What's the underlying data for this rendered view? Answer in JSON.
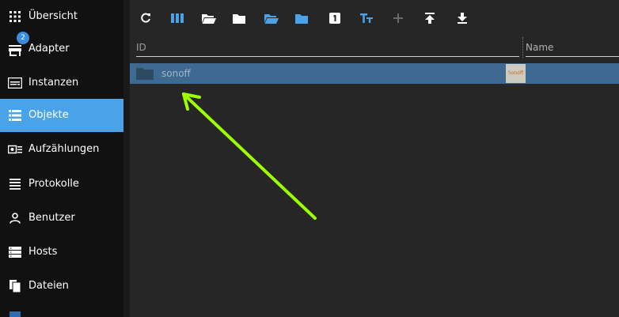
{
  "sidebar": {
    "items": [
      {
        "label": "Übersicht",
        "icon": "grid-icon"
      },
      {
        "label": "Adapter",
        "icon": "store-icon",
        "badge": "2"
      },
      {
        "label": "Instanzen",
        "icon": "instances-icon"
      },
      {
        "label": "Objekte",
        "icon": "list-icon",
        "active": true
      },
      {
        "label": "Aufzählungen",
        "icon": "enum-icon"
      },
      {
        "label": "Protokolle",
        "icon": "log-icon"
      },
      {
        "label": "Benutzer",
        "icon": "user-icon"
      },
      {
        "label": "Hosts",
        "icon": "hosts-icon"
      },
      {
        "label": "Dateien",
        "icon": "files-icon"
      }
    ]
  },
  "toolbar": {
    "buttons": [
      "refresh-icon",
      "columns-icon",
      "folder-open-icon",
      "folder-icon",
      "folder-open-blue-icon",
      "folder-blue-icon",
      "one-icon",
      "text-size-icon",
      "plus-icon",
      "upload-icon",
      "download-icon"
    ]
  },
  "table": {
    "columns": {
      "id": "ID",
      "name": "Name"
    },
    "rows": [
      {
        "id": "sonoff",
        "thumb_text": "Sonoff"
      }
    ]
  },
  "colors": {
    "accent": "#4aa3e8",
    "selected_row": "#3e6a91",
    "annotation_arrow": "#9cff00"
  }
}
